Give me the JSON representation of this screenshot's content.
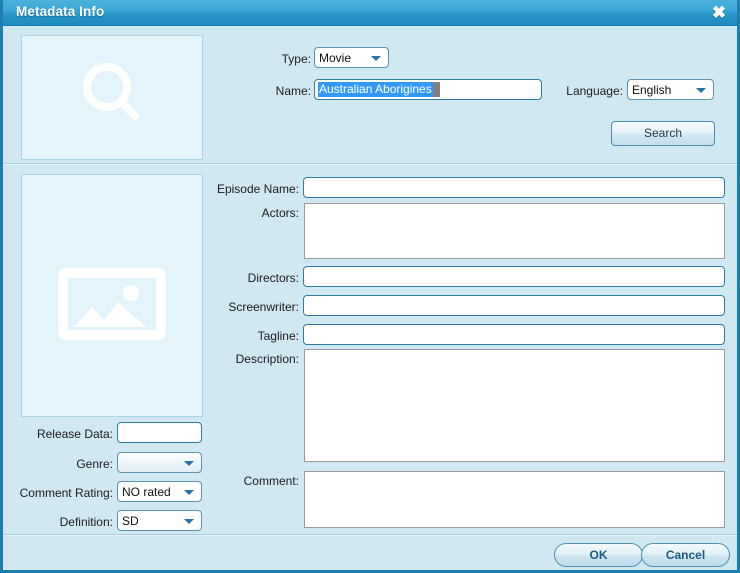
{
  "window": {
    "title": "Metadata Info",
    "close_icon": "close-x-icon",
    "accent_color": "#2694c6",
    "background_color": "#cfe8f2"
  },
  "placeholders": {
    "search_preview_icon": "magnifier-icon",
    "poster_preview_icon": "image-placeholder-icon"
  },
  "search_panel": {
    "type_label": "Type:",
    "type_value": "Movie",
    "type_options": [
      "Movie"
    ],
    "name_label": "Name:",
    "name_value": "Australian Aborigines",
    "name_selected": true,
    "language_label": "Language:",
    "language_value": "English",
    "language_options": [
      "English"
    ],
    "search_button": "Search"
  },
  "details": {
    "episode_name_label": "Episode Name:",
    "episode_name_value": "",
    "actors_label": "Actors:",
    "actors_value": "",
    "directors_label": "Directors:",
    "directors_value": "",
    "screenwriter_label": "Screenwriter:",
    "screenwriter_value": "",
    "tagline_label": "Tagline:",
    "tagline_value": "",
    "description_label": "Description:",
    "description_value": "",
    "comment_label": "Comment:",
    "comment_value": ""
  },
  "left_fields": {
    "release_data_label": "Release Data:",
    "release_data_value": "",
    "genre_label": "Genre:",
    "genre_value": "",
    "genre_options": [],
    "comment_rating_label": "Comment Rating:",
    "comment_rating_value": "NO rated",
    "comment_rating_options": [
      "NO rated"
    ],
    "definition_label": "Definition:",
    "definition_value": "SD",
    "definition_options": [
      "SD"
    ]
  },
  "footer": {
    "ok_label": "OK",
    "cancel_label": "Cancel"
  }
}
